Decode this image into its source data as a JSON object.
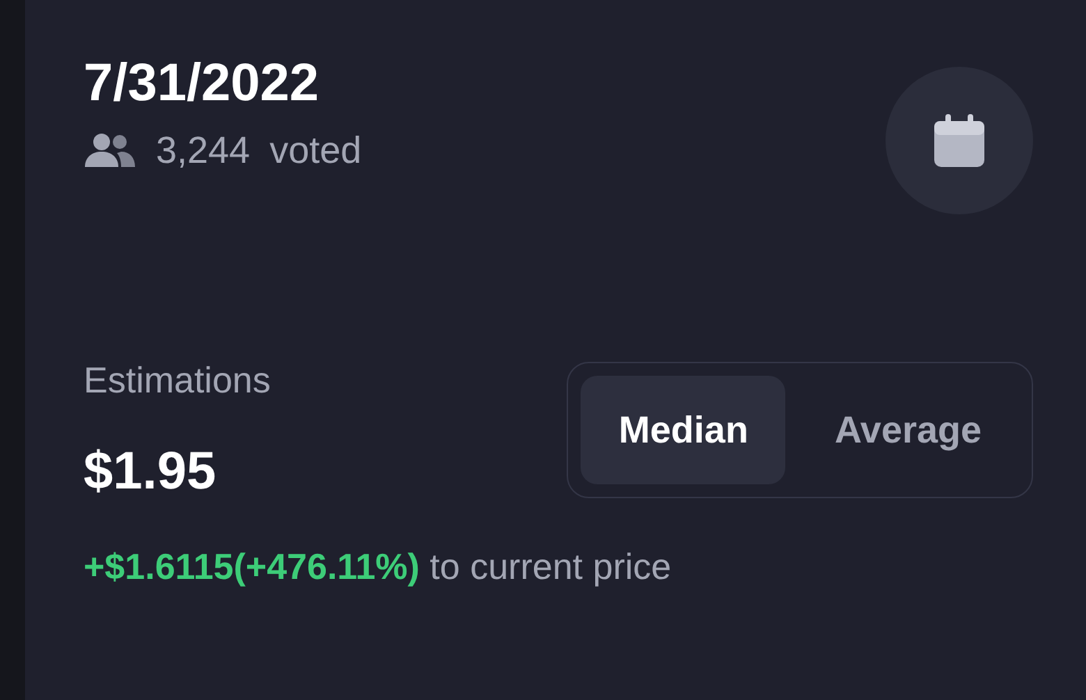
{
  "header": {
    "date": "7/31/2022",
    "votes": "3,244",
    "votes_label": "voted"
  },
  "estimations": {
    "label": "Estimations",
    "value": "$1.95",
    "change": "+$1.6115(+476.11%)",
    "change_suffix": "to current price",
    "toggle": [
      {
        "label": "Median",
        "selected": true
      },
      {
        "label": "Average",
        "selected": false
      }
    ]
  }
}
